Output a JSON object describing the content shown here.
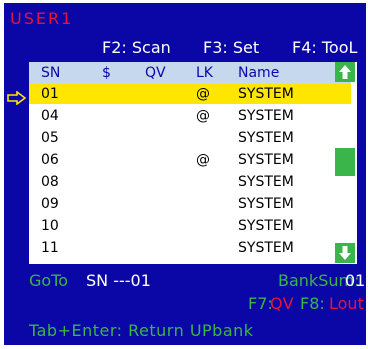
{
  "user_label": "USER1",
  "function_keys": {
    "scan": "F2: Scan",
    "set": "F3: Set",
    "tool": "F4: TooL"
  },
  "columns": [
    "SN",
    "$",
    "QV",
    "LK",
    "Name"
  ],
  "rows": [
    {
      "sn": "01",
      "dollar": "",
      "qv": "",
      "lk": "@",
      "name": "SYSTEM",
      "selected": true
    },
    {
      "sn": "04",
      "dollar": "",
      "qv": "",
      "lk": "@",
      "name": "SYSTEM"
    },
    {
      "sn": "05",
      "dollar": "",
      "qv": "",
      "lk": "",
      "name": "SYSTEM"
    },
    {
      "sn": "06",
      "dollar": "",
      "qv": "",
      "lk": "@",
      "name": "SYSTEM"
    },
    {
      "sn": "08",
      "dollar": "",
      "qv": "",
      "lk": "",
      "name": "SYSTEM"
    },
    {
      "sn": "09",
      "dollar": "",
      "qv": "",
      "lk": "",
      "name": "SYSTEM"
    },
    {
      "sn": "10",
      "dollar": "",
      "qv": "",
      "lk": "",
      "name": "SYSTEM"
    },
    {
      "sn": "11",
      "dollar": "",
      "qv": "",
      "lk": "",
      "name": "SYSTEM"
    }
  ],
  "goto": {
    "label": "GoTo",
    "value": "SN ---01"
  },
  "bank": {
    "label": "BankSum:",
    "value": "01"
  },
  "f7": {
    "key": "F7:",
    "value": "QV"
  },
  "f8": {
    "key": "F8:",
    "value": "Lout"
  },
  "footer_hint": "Tab+Enter: Return UPbank",
  "colors": {
    "background": "#0b06a6",
    "accent_green": "#3ab54a",
    "accent_red": "#e8123a",
    "selection": "#ffe600",
    "header": "#c6d8ee"
  },
  "icons": [
    "up-arrow-icon",
    "down-arrow-icon",
    "pointer-arrow-icon"
  ]
}
